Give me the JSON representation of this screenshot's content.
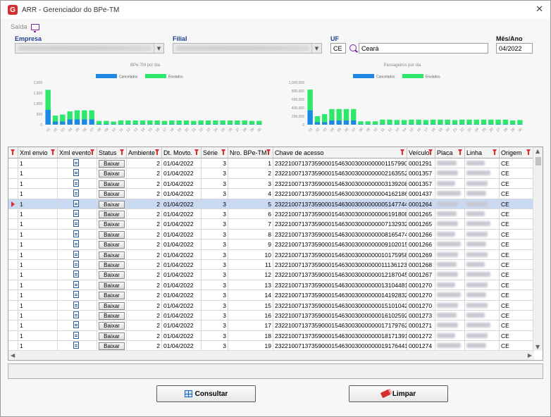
{
  "window": {
    "title": "ARR - Gerenciador do BPe-TM",
    "logo_letter": "G",
    "close_glyph": "✕"
  },
  "menu": {
    "saida_label": "Saída"
  },
  "filters": {
    "empresa_label": "Empresa",
    "filial_label": "Filial",
    "uf_label": "UF",
    "uf_code": "CE",
    "uf_name": "Ceará",
    "mes_ano_label": "Mês/Ano",
    "mes_ano_value": "04/2022"
  },
  "charts": [
    {
      "title": "BPe-TM por dia",
      "legend": [
        "Cancelados",
        "Enviados"
      ],
      "colors": {
        "cancelados": "#1e88e5",
        "enviados": "#2ee86b"
      },
      "y_ticks": [
        "2,000",
        "1,500",
        "1,000",
        "500",
        "0"
      ],
      "ylim": [
        0,
        2000
      ],
      "x_labels": [
        "01",
        "02",
        "03",
        "04",
        "05",
        "06",
        "07",
        "08",
        "09",
        "10",
        "11",
        "12",
        "13",
        "14",
        "15",
        "16",
        "17",
        "18",
        "19",
        "20",
        "21",
        "22",
        "23",
        "24",
        "25",
        "26",
        "27",
        "28",
        "29",
        "30"
      ],
      "series": [
        {
          "name": "Cancelados",
          "values": [
            700,
            150,
            150,
            250,
            250,
            250,
            250,
            30,
            30,
            20,
            20,
            20,
            20,
            20,
            20,
            20,
            20,
            20,
            20,
            20,
            20,
            20,
            20,
            20,
            20,
            20,
            20,
            20,
            20,
            20
          ]
        },
        {
          "name": "Enviados",
          "values": [
            1650,
            430,
            480,
            630,
            680,
            680,
            680,
            180,
            180,
            150,
            200,
            200,
            200,
            200,
            200,
            200,
            180,
            200,
            200,
            200,
            180,
            200,
            200,
            200,
            200,
            200,
            200,
            200,
            180,
            180
          ]
        }
      ]
    },
    {
      "title": "Passageiros por dia",
      "legend": [
        "Cancelados",
        "Enviados"
      ],
      "colors": {
        "cancelados": "#1e88e5",
        "enviados": "#2ee86b"
      },
      "y_ticks": [
        "1,000,000",
        "800,000",
        "600,000",
        "400,000",
        "200,000",
        "0"
      ],
      "ylim": [
        0,
        1000000
      ],
      "x_labels": [
        "01",
        "02",
        "03",
        "04",
        "05",
        "06",
        "07",
        "08",
        "09",
        "10",
        "11",
        "12",
        "13",
        "14",
        "15",
        "16",
        "17",
        "18",
        "19",
        "20",
        "21",
        "22",
        "23",
        "24",
        "25",
        "26",
        "27",
        "28",
        "29",
        "30"
      ],
      "series": [
        {
          "name": "Cancelados",
          "values": [
            340000,
            60000,
            60000,
            100000,
            100000,
            100000,
            100000,
            10000,
            10000,
            10000,
            10000,
            10000,
            10000,
            10000,
            10000,
            10000,
            10000,
            10000,
            10000,
            10000,
            10000,
            10000,
            10000,
            10000,
            10000,
            10000,
            10000,
            10000,
            10000,
            10000
          ]
        },
        {
          "name": "Enviados",
          "values": [
            830000,
            200000,
            250000,
            370000,
            370000,
            370000,
            370000,
            80000,
            80000,
            80000,
            120000,
            120000,
            110000,
            110000,
            120000,
            120000,
            110000,
            120000,
            120000,
            120000,
            110000,
            120000,
            120000,
            120000,
            120000,
            120000,
            120000,
            120000,
            100000,
            110000
          ]
        }
      ]
    }
  ],
  "grid": {
    "columns": [
      "Xml envio",
      "Xml evento",
      "Status",
      "Ambiente",
      "Dt. Movto.",
      "Série",
      "Nro. BPe-TM",
      "Chave de acesso",
      "Veículo",
      "Placa",
      "Linha",
      "Origem"
    ],
    "status_button_label": "Baixar",
    "selected_row_index": 4,
    "rows": [
      {
        "xml_envio": "1",
        "ambiente": "2",
        "dt": "01/04/2022",
        "serie": "3",
        "nro": "1",
        "chave": "2322100713735900015463003000000001157990...",
        "veiculo": "0001291",
        "origem": "CE"
      },
      {
        "xml_envio": "1",
        "ambiente": "2",
        "dt": "01/04/2022",
        "serie": "3",
        "nro": "2",
        "chave": "23221007137359000154630030000000021635520...",
        "veiculo": "0001357",
        "origem": "CE"
      },
      {
        "xml_envio": "1",
        "ambiente": "2",
        "dt": "01/04/2022",
        "serie": "3",
        "nro": "3",
        "chave": "23221007137359000154630030000000031392080...",
        "veiculo": "0001357",
        "origem": "CE"
      },
      {
        "xml_envio": "1",
        "ambiente": "2",
        "dt": "01/04/2022",
        "serie": "3",
        "nro": "4",
        "chave": "23221007137359000154630030000000041621860...",
        "veiculo": "0001437",
        "origem": "CE"
      },
      {
        "xml_envio": "1",
        "ambiente": "2",
        "dt": "01/04/2022",
        "serie": "3",
        "nro": "5",
        "chave": "23221007137359000154630030000000051477440...",
        "veiculo": "0001264",
        "origem": "CE"
      },
      {
        "xml_envio": "1",
        "ambiente": "2",
        "dt": "01/04/2022",
        "serie": "3",
        "nro": "6",
        "chave": "23221007137359000154630030000000061918080...",
        "veiculo": "0001265",
        "origem": "CE"
      },
      {
        "xml_envio": "1",
        "ambiente": "2",
        "dt": "01/04/2022",
        "serie": "3",
        "nro": "7",
        "chave": "23221007137359000154630030000000071329320...",
        "veiculo": "0001265",
        "origem": "CE"
      },
      {
        "xml_envio": "1",
        "ambiente": "2",
        "dt": "01/04/2022",
        "serie": "3",
        "nro": "8",
        "chave": "23221007137359000154630030000000081654740...",
        "veiculo": "0001266",
        "origem": "CE"
      },
      {
        "xml_envio": "1",
        "ambiente": "2",
        "dt": "01/04/2022",
        "serie": "3",
        "nro": "9",
        "chave": "23221007137359000154630030000000091020150...",
        "veiculo": "0001266",
        "origem": "CE"
      },
      {
        "xml_envio": "1",
        "ambiente": "2",
        "dt": "01/04/2022",
        "serie": "3",
        "nro": "10",
        "chave": "23221007137359000154630030000000101759580...",
        "veiculo": "0001269",
        "origem": "CE"
      },
      {
        "xml_envio": "1",
        "ambiente": "2",
        "dt": "01/04/2022",
        "serie": "3",
        "nro": "11",
        "chave": "23221007137359000154630030000000111361230...",
        "veiculo": "0001268",
        "origem": "CE"
      },
      {
        "xml_envio": "1",
        "ambiente": "2",
        "dt": "01/04/2022",
        "serie": "3",
        "nro": "12",
        "chave": "23221007137359000154630030000000121870450...",
        "veiculo": "0001267",
        "origem": "CE"
      },
      {
        "xml_envio": "1",
        "ambiente": "2",
        "dt": "01/04/2022",
        "serie": "3",
        "nro": "13",
        "chave": "23221007137359000154630030000000131044810...",
        "veiculo": "0001270",
        "origem": "CE"
      },
      {
        "xml_envio": "1",
        "ambiente": "2",
        "dt": "01/04/2022",
        "serie": "3",
        "nro": "14",
        "chave": "23221007137359000154630030000000141928320...",
        "veiculo": "0001270",
        "origem": "CE"
      },
      {
        "xml_envio": "1",
        "ambiente": "2",
        "dt": "01/04/2022",
        "serie": "3",
        "nro": "15",
        "chave": "23221007137359000154630030000000151010420...",
        "veiculo": "0001270",
        "origem": "CE"
      },
      {
        "xml_envio": "1",
        "ambiente": "2",
        "dt": "01/04/2022",
        "serie": "3",
        "nro": "16",
        "chave": "23221007137359000154630030000000161025920...",
        "veiculo": "0001273",
        "origem": "CE"
      },
      {
        "xml_envio": "1",
        "ambiente": "2",
        "dt": "01/04/2022",
        "serie": "3",
        "nro": "17",
        "chave": "23221007137359000154630030000000171797620...",
        "veiculo": "0001271",
        "origem": "CE"
      },
      {
        "xml_envio": "1",
        "ambiente": "2",
        "dt": "01/04/2022",
        "serie": "3",
        "nro": "18",
        "chave": "23221007137359000154630030000000181713910...",
        "veiculo": "0001272",
        "origem": "CE"
      },
      {
        "xml_envio": "1",
        "ambiente": "2",
        "dt": "01/04/2022",
        "serie": "3",
        "nro": "19",
        "chave": "23221007137359000154630030000000191764410...",
        "veiculo": "0001274",
        "origem": "CE"
      }
    ]
  },
  "buttons": {
    "consultar_label": "Consultar",
    "limpar_label": "Limpar"
  }
}
